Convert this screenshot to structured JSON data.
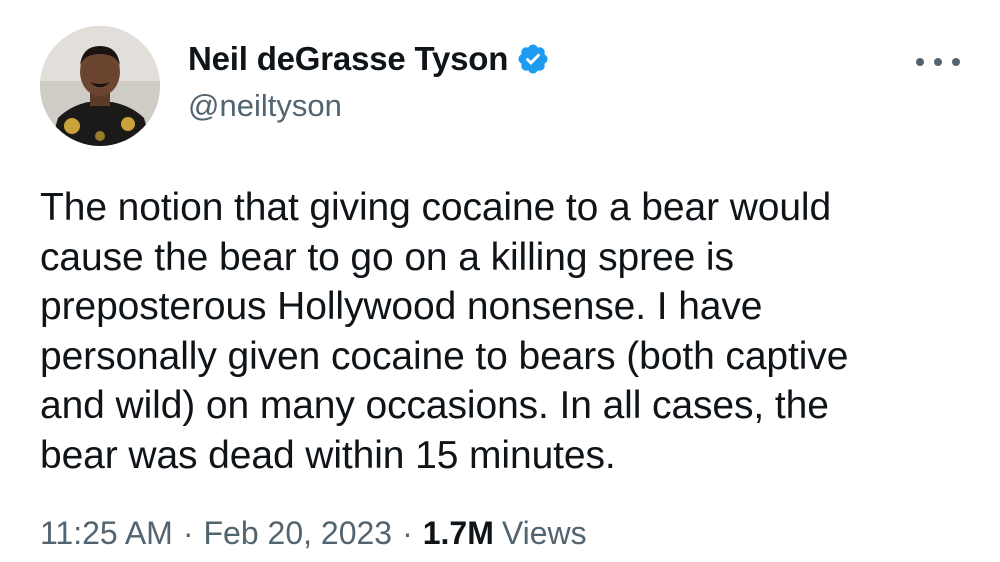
{
  "author": {
    "display_name": "Neil deGrasse Tyson",
    "handle": "@neiltyson",
    "verified_icon": "verified-badge-icon",
    "verified_color": "#1d9bf0"
  },
  "tweet": {
    "lines": [
      "The notion that giving cocaine to a bear would",
      "cause the bear to go on a killing spree is",
      "preposterous Hollywood nonsense. I have",
      "personally given cocaine to bears (both captive",
      "and wild) on many occasions. In all cases, the",
      "bear was dead within 15 minutes."
    ]
  },
  "meta": {
    "time": "11:25 AM",
    "separator": "·",
    "date": "Feb 20, 2023",
    "views_count": "1.7M",
    "views_label": "Views"
  },
  "actions": {
    "more_icon": "more-horizontal-icon"
  }
}
